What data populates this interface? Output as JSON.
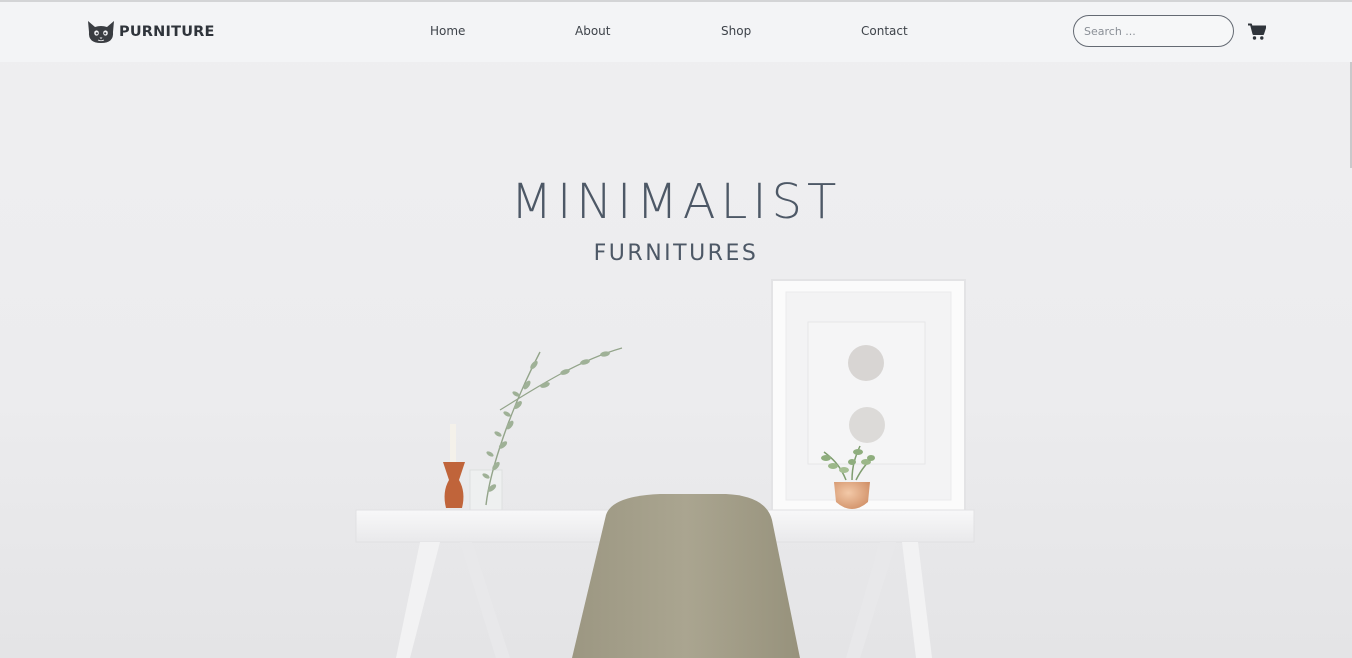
{
  "brand": {
    "name": "PURNITURE",
    "logo_icon": "cat-icon"
  },
  "nav": {
    "items": [
      {
        "label": "Home"
      },
      {
        "label": "About"
      },
      {
        "label": "Shop"
      },
      {
        "label": "Contact"
      }
    ]
  },
  "search": {
    "placeholder": "Search ...",
    "value": ""
  },
  "cart": {
    "icon": "cart-icon"
  },
  "hero": {
    "title": "MINIMALIST",
    "subtitle": "FURNITURES"
  },
  "colors": {
    "text_dark": "#2f343b",
    "hero_text": "#4d5866",
    "navbar_bg": "#f3f4f6",
    "chair": "#a8a38d"
  }
}
